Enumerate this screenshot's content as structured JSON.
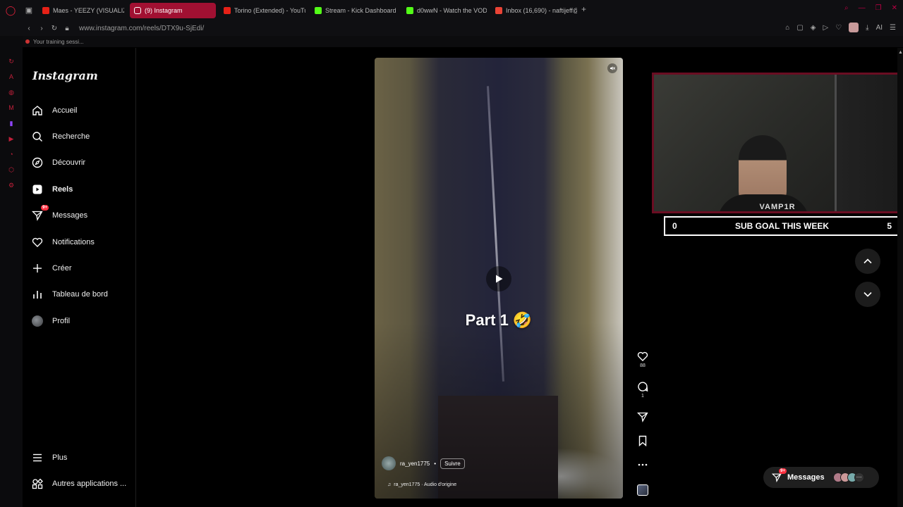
{
  "browser": {
    "tabs": [
      {
        "label": "Maes - YEEZY (VISUALIZE",
        "favicon_color": "#e62117"
      },
      {
        "label": "(9) Instagram",
        "favicon_color": "#ffffff",
        "active": true
      },
      {
        "label": "Torino (Extended) - YouTu",
        "favicon_color": "#e62117"
      },
      {
        "label": "Stream - Kick Dashboard",
        "favicon_color": "#53fc18"
      },
      {
        "label": "d0wwN - Watch the VOD",
        "favicon_color": "#53fc18"
      },
      {
        "label": "Inbox (16,690) - naftijeff@",
        "favicon_color": "#ea4335"
      }
    ],
    "url": "www.instagram.com/reels/DTX9u-SjEdi/",
    "infobar_text": "Your training sessi...",
    "aria_label": "AI"
  },
  "instagram": {
    "logo": "Instagram",
    "nav": [
      {
        "label": "Accueil",
        "icon": "home-icon"
      },
      {
        "label": "Recherche",
        "icon": "search-icon"
      },
      {
        "label": "Découvrir",
        "icon": "compass-icon"
      },
      {
        "label": "Reels",
        "icon": "reels-icon",
        "active": true
      },
      {
        "label": "Messages",
        "icon": "messenger-icon",
        "badge": "9+"
      },
      {
        "label": "Notifications",
        "icon": "heart-icon"
      },
      {
        "label": "Créer",
        "icon": "plus-icon"
      },
      {
        "label": "Tableau de bord",
        "icon": "dashboard-icon"
      },
      {
        "label": "Profil",
        "icon": "profile-avatar"
      }
    ],
    "more_label": "Plus",
    "other_apps_label": "Autres applications ..."
  },
  "reel": {
    "caption_overlay": "Part 1 🤣",
    "username": "ra_yen1775",
    "follow_label": "Suivre",
    "audio_label": "ra_yen1775 · Audio d'origine",
    "likes": "88",
    "comments": "1"
  },
  "stream_overlay": {
    "streamer_tag": "VAMP1R",
    "sub_goal_current": "0",
    "sub_goal_label": "SUB GOAL THIS WEEK",
    "sub_goal_target": "5"
  },
  "messages_pill": {
    "label": "Messages",
    "badge": "9+"
  }
}
